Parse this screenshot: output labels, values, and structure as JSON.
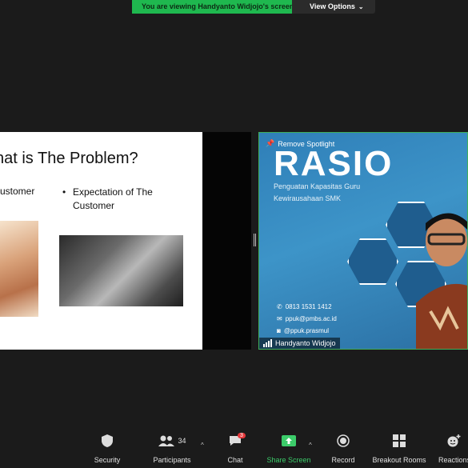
{
  "banner": {
    "viewing_text": "You are viewing Handyanto Widjojo's screen",
    "view_options": "View Options"
  },
  "slide": {
    "title": "hat is The Problem?",
    "bullet_left": "ustomer",
    "bullet_right": "Expectation of The Customer"
  },
  "video": {
    "remove_spotlight": "Remove Spotlight",
    "brand": "RASIO",
    "subtitle_1": "Penguatan Kapasitas Guru",
    "subtitle_2": "Kewirausahaan SMK",
    "phone": "0813 1531 1412",
    "email": "ppuk@pmbs.ac.id",
    "instagram": "@ppuk.prasmul",
    "participant_name": "Handyanto Widjojo"
  },
  "toolbar": {
    "security": "Security",
    "participants": "Participants",
    "participants_count": "34",
    "chat": "Chat",
    "chat_badge": "3",
    "share_screen": "Share Screen",
    "record": "Record",
    "breakout_rooms": "Breakout Rooms",
    "reactions": "Reactions"
  },
  "colors": {
    "share_green": "#3ccc6a",
    "banner_green": "#1fb84f",
    "chat_badge": "#e5383b"
  }
}
